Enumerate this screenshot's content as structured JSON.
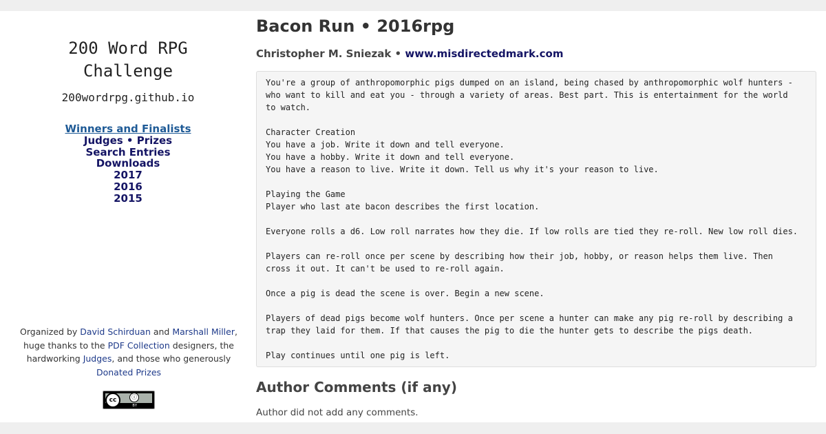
{
  "sidebar": {
    "title_line1": "200 Word RPG",
    "title_line2": "Challenge",
    "url": "200wordrpg.github.io",
    "nav": {
      "winners": "Winners and Finalists",
      "judges": "Judges",
      "separator": " • ",
      "prizes": "Prizes",
      "search": "Search Entries",
      "downloads": "Downloads",
      "year_2017": "2017",
      "year_2016": "2016",
      "year_2015": "2015"
    },
    "credits": {
      "organized_by": "Organized by ",
      "organizer1": "David Schirduan",
      "and": " and ",
      "organizer2": "Marshall Miller",
      "thanks_prefix": ", huge thanks to the ",
      "pdf_collection": "PDF Collection",
      "thanks_mid": " designers, the hardworking ",
      "judges": "Judges",
      "thanks_suffix": ", and those who generously ",
      "donated_prizes": "Donated Prizes"
    },
    "license": {
      "cc": "cc",
      "by_symbol": "ⓘ",
      "by_label": "BY"
    }
  },
  "main": {
    "title": "Bacon Run • 2016rpg",
    "author": "Christopher M. Sniezak",
    "byline_sep": " • ",
    "author_site": "www.misdirectedmark.com",
    "entry_lines": [
      "You're a group of anthropomorphic pigs dumped on an island, being chased by anthropomorphic wolf hunters -",
      "who want to kill and eat you - through a variety of areas. Best part. This is entertainment for the world",
      "to watch.",
      "",
      "Character Creation",
      "You have a job. Write it down and tell everyone.",
      "You have a hobby. Write it down and tell everyone.",
      "You have a reason to live. Write it down. Tell us why it's your reason to live.",
      "",
      "Playing the Game",
      "Player who last ate bacon describes the first location.",
      "",
      "Everyone rolls a d6. Low roll narrates how they die. If low rolls are tied they re-roll. New low roll dies.",
      "",
      "Players can re-roll once per scene by describing how their job, hobby, or reason helps them live. Then",
      "cross it out. It can't be used to re-roll again.",
      "",
      "Once a pig is dead the scene is over. Begin a new scene.",
      "",
      "Players of dead pigs become wolf hunters. Once per scene a hunter can make any pig re-roll by describing a",
      "trap they laid for them. If that causes the pig to die the hunter gets to describe the pigs death.",
      "",
      "Play continues until one pig is left."
    ],
    "comments_heading": "Author Comments (if any)",
    "comments_text": "Author did not add any comments."
  }
}
